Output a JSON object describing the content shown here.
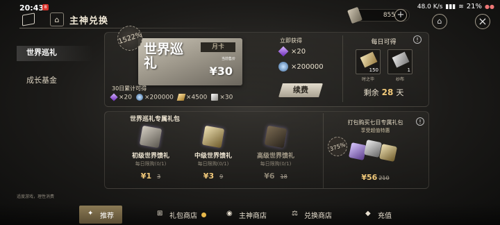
{
  "status": {
    "time": "20:43",
    "notif": "8",
    "battery": "21%",
    "net": "48.0 K/s"
  },
  "header": {
    "title": "主神兑换",
    "home_glyph": "⌂"
  },
  "currency": {
    "value": "855"
  },
  "sidebar": {
    "items": [
      {
        "label": "世界巡礼"
      },
      {
        "label": "成长基金"
      }
    ]
  },
  "footnote": "适度游戏，理性消费",
  "card": {
    "title": "世界巡礼",
    "tag": "月卡",
    "note": "当前售价",
    "price": "¥30",
    "badge": "1522%"
  },
  "accumulate": {
    "label": "30日累计可得",
    "items": [
      {
        "icon": "purple-crystal-icon",
        "qty": "×20"
      },
      {
        "icon": "blue-orb-icon",
        "qty": "×200000"
      },
      {
        "icon": "gold-ingot-icon",
        "qty": "×4500"
      },
      {
        "icon": "white-cloth-icon",
        "qty": "×30"
      }
    ]
  },
  "instant": {
    "label": "立即获得",
    "items": [
      {
        "qty": "×20"
      },
      {
        "qty": "×200000"
      }
    ],
    "renew_label": "续费"
  },
  "daily": {
    "title": "每日可得",
    "items": [
      {
        "qty": "150",
        "name": "时之华"
      },
      {
        "qty": "1",
        "name": "纱布"
      }
    ],
    "remain_label": "剩余",
    "remain_value": "28",
    "remain_unit": "天"
  },
  "gifts": {
    "title": "世界巡礼专属礼包",
    "packs": [
      {
        "name": "初级世界馈礼",
        "limit": "每日限购(0/1)",
        "price": "¥1",
        "old": "3"
      },
      {
        "name": "中级世界馈礼",
        "limit": "每日限购(0/1)",
        "price": "¥3",
        "old": "9"
      },
      {
        "name": "高级世界馈礼",
        "limit": "每日限购(0/1)",
        "price": "¥6",
        "old": "18"
      }
    ],
    "bundle": {
      "title": "打包购买七日专属礼包",
      "sub": "享受超值特惠",
      "badge": "375%",
      "price": "¥56",
      "old": "210"
    }
  },
  "nav": {
    "items": [
      {
        "label": "推荐"
      },
      {
        "label": "礼包商店"
      },
      {
        "label": "主神商店"
      },
      {
        "label": "兑换商店"
      },
      {
        "label": "充值"
      }
    ]
  },
  "colors": {
    "accent": "#f1c97a",
    "panel": "#2f2d29"
  }
}
